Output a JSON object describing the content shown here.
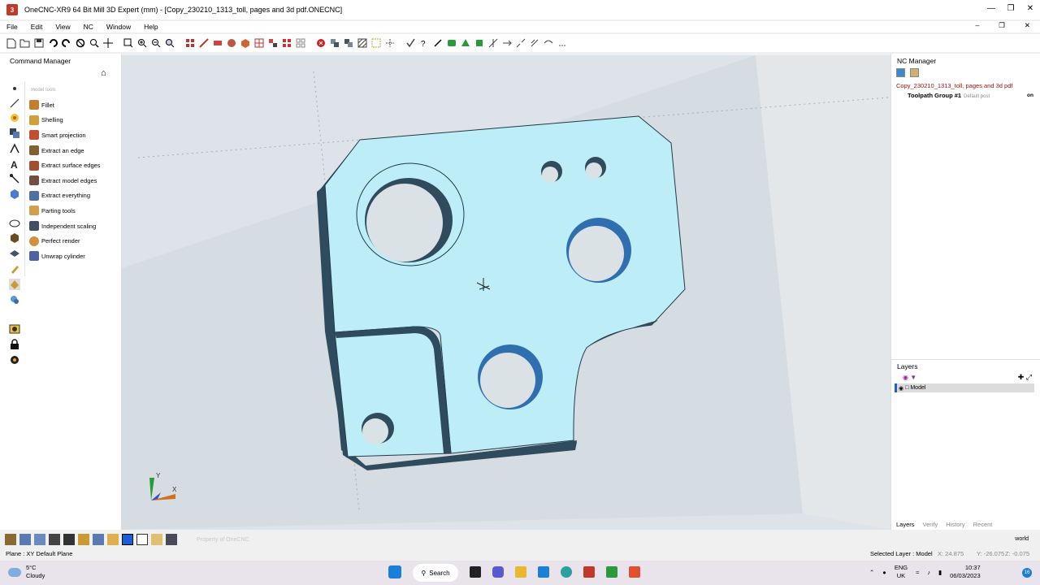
{
  "window": {
    "title": "OneCNC-XR9  64 Bit Mill 3D Expert (mm) - [Copy_230210_1313_toll, pages and 3d pdf.ONECNC]",
    "app_icon_letter": "3",
    "controls": [
      "minimize",
      "maximize",
      "close"
    ]
  },
  "menu": [
    "File",
    "Edit",
    "View",
    "NC",
    "Window",
    "Help"
  ],
  "command_manager": {
    "title": "Command Manager",
    "subtitle": "model tools",
    "items": [
      {
        "label": "Fillet",
        "icon": "fillet-icon",
        "color": "#c08030"
      },
      {
        "label": "Shelling",
        "icon": "shelling-icon",
        "color": "#d0a040"
      },
      {
        "label": "Smart projection",
        "icon": "smart-projection-icon",
        "color": "#c05030"
      },
      {
        "label": "Extract an edge",
        "icon": "extract-edge-icon",
        "color": "#806030"
      },
      {
        "label": "Extract surface edges",
        "icon": "extract-surface-edges-icon",
        "color": "#a05030"
      },
      {
        "label": "Extract model edges",
        "icon": "extract-model-edges-icon",
        "color": "#705040"
      },
      {
        "label": "Extract everything",
        "icon": "extract-everything-icon",
        "color": "#5070a0"
      },
      {
        "label": "Parting tools",
        "icon": "parting-tools-icon",
        "color": "#d0a050"
      },
      {
        "label": "Independent scaling",
        "icon": "independent-scaling-icon",
        "color": "#405060"
      },
      {
        "label": "Perfect render",
        "icon": "perfect-render-icon",
        "color": "#d09040"
      },
      {
        "label": "Unwrap cylinder",
        "icon": "unwrap-cylinder-icon",
        "color": "#5060a0"
      }
    ]
  },
  "nc_manager": {
    "title": "NC Manager",
    "file": "Copy_230210_1313_toll, pages and 3d pdf",
    "group": "Toolpath Group #1",
    "default_post": "Default post",
    "on": "on"
  },
  "layers": {
    "title": "Layers",
    "model": "Model",
    "tabs": [
      "Layers",
      "Verify",
      "History",
      "Recent"
    ]
  },
  "viewport": {
    "axis_x": "X",
    "axis_y": "Y",
    "part_color": "#bdeef8",
    "wall_color": "#2f4b5e"
  },
  "bottom": {
    "placeholder": "Property of OneCNC",
    "world": "world"
  },
  "status": {
    "plane": "Plane : XY Default Plane",
    "selected_layer": "Selected Layer : Model",
    "x": "X: 24.875",
    "y": "Y: -26.075",
    "z": "Z: -0.075"
  },
  "taskbar": {
    "temp": "5°C",
    "weather": "Cloudy",
    "search": "Search",
    "lang1": "ENG",
    "lang2": "UK",
    "time": "10:37",
    "date": "06/03/2023",
    "notifications": "16"
  }
}
